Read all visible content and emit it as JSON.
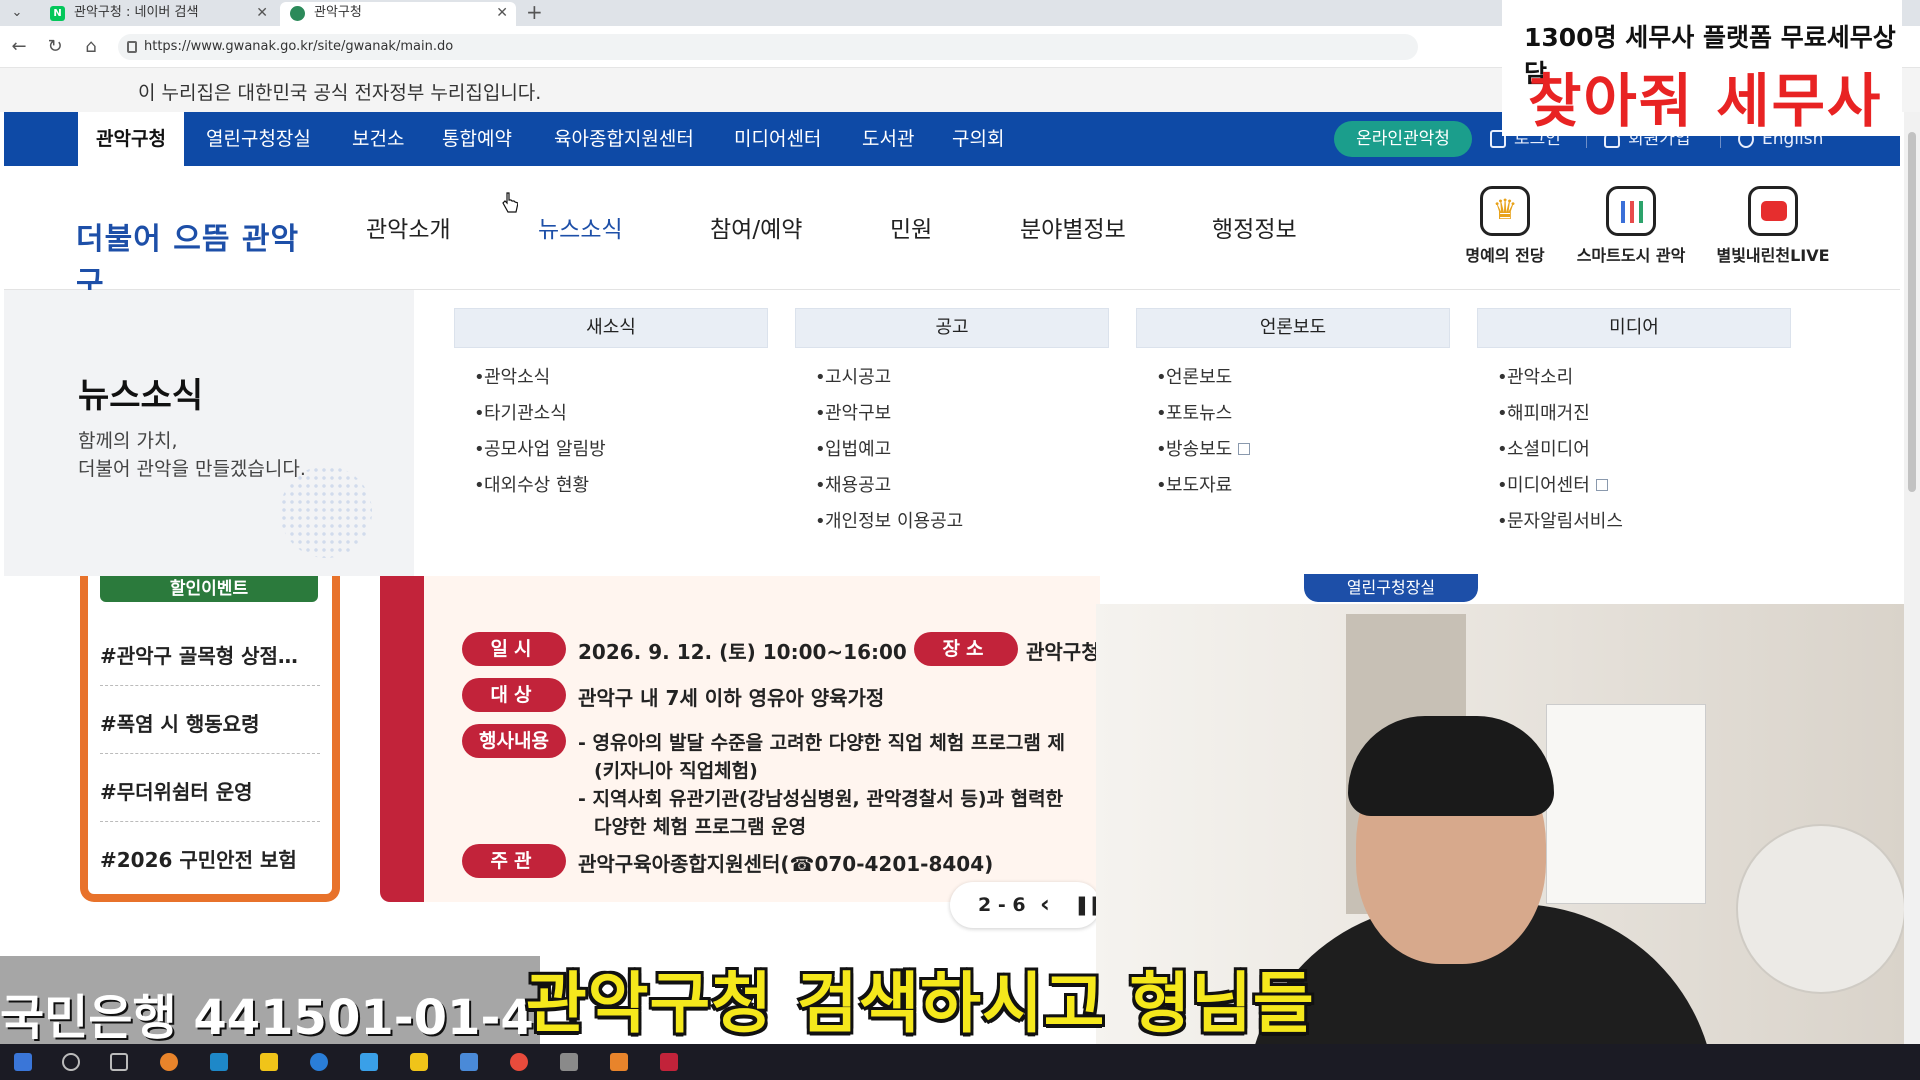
{
  "browser": {
    "tabs": [
      {
        "title": "관악구청 : 네이버 검색",
        "active": false
      },
      {
        "title": "관악구청",
        "active": true
      }
    ],
    "url": "https://www.gwanak.go.kr/site/gwanak/main.do"
  },
  "gov_notice": "이 누리집은 대한민국 공식 전자정부 누리집입니다.",
  "topnav": {
    "items": [
      "관악구청",
      "열린구청장실",
      "보건소",
      "통합예약",
      "육아종합지원센터",
      "미디어센터",
      "도서관",
      "구의회"
    ],
    "online_button": "온라인관악청",
    "login": "로그인",
    "signup": "회원가입",
    "english": "English"
  },
  "header": {
    "logo_text": "더불어 으뜸 관악구",
    "menu": [
      "관악소개",
      "뉴스소식",
      "참여/예약",
      "민원",
      "분야별정보",
      "행정정보"
    ],
    "quick_links": [
      {
        "label": "명예의 전당",
        "icon": "crown-icon"
      },
      {
        "label": "스마트도시 관악",
        "icon": "chart-icon"
      },
      {
        "label": "별빛내린천LIVE",
        "icon": "play-icon"
      }
    ]
  },
  "mega": {
    "title": "뉴스소식",
    "desc1": "함께의 가치,",
    "desc2": "더불어 관악을 만들겠습니다.",
    "columns": [
      {
        "head": "새소식",
        "items": [
          "관악소식",
          "타기관소식",
          "공모사업 알림방",
          "대외수상 현황"
        ]
      },
      {
        "head": "공고",
        "items": [
          "고시공고",
          "관악구보",
          "입법예고",
          "채용공고",
          "개인정보 이용공고"
        ]
      },
      {
        "head": "언론보도",
        "items": [
          "언론보도",
          "포토뉴스",
          "방송보도",
          "보도자료"
        ]
      },
      {
        "head": "미디어",
        "items": [
          "관악소리",
          "해피매거진",
          "소셜미디어",
          "미디어센터",
          "문자알림서비스"
        ]
      }
    ]
  },
  "content": {
    "sale_label": "할인이벤트",
    "tags": [
      "#관악구 골목형 상점…",
      "#폭염 시 행동요령",
      "#무더위쉼터 운영",
      "#2026 구민안전 보험"
    ],
    "banner": {
      "rows": [
        {
          "pill": "일시",
          "text": "2026. 9. 12. (토) 10:00~16:00"
        },
        {
          "pill": "대상",
          "text": "관악구 내 7세 이하 영유아 양육가정"
        },
        {
          "pill": "행사내용",
          "text": "- 영유아의 발달 수준을 고려한 다양한 직업 체험 프로그램 제"
        },
        {
          "pill": "",
          "text": "(키자니아 직업체험)"
        },
        {
          "pill": "",
          "text": "- 지역사회 유관기관(강남성심병원, 관악경찰서 등)과 협력한"
        },
        {
          "pill": "",
          "text": "다양한 체험 프로그램 운영"
        },
        {
          "pill": "주관",
          "text": "관악구육아종합지원센터(☎070-4201-8404)"
        }
      ],
      "place_pill": "장소",
      "place_text": "관악구청"
    },
    "pager": "2 - 6",
    "blue_pill": "열린구청장실"
  },
  "overlay": {
    "ad_line1": "1300명 세무사 플랫폼 무료세무상담",
    "ad_line2": "찾아줘 세무사",
    "bank_text": "국민은행 441501-01-4",
    "subtitle": "관악구청 검색하시고 형님들"
  },
  "colors": {
    "nav_blue": "#0e4aa6",
    "online_teal": "#1b9e8c",
    "accent_red": "#c2233a",
    "subtitle_yellow": "#f5e81c"
  }
}
